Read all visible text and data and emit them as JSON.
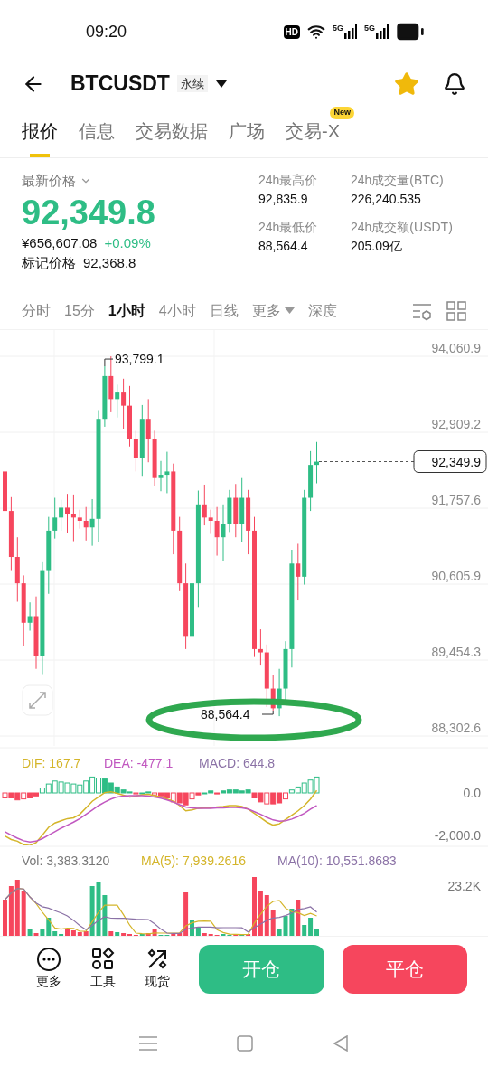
{
  "status_bar": {
    "time": "09:20",
    "hd": "HD",
    "sims": [
      "5G",
      "5G"
    ]
  },
  "header": {
    "symbol": "BTCUSDT",
    "contract_tag": "永续",
    "favorite": true
  },
  "tabs": [
    {
      "label": "报价",
      "selected": true
    },
    {
      "label": "信息",
      "selected": false
    },
    {
      "label": "交易数据",
      "selected": false
    },
    {
      "label": "广场",
      "selected": false
    },
    {
      "label": "交易-X",
      "selected": false,
      "badge": "New"
    }
  ],
  "price": {
    "label": "最新价格",
    "last": "92,349.8",
    "cny": "¥656,607.08",
    "change": "+0.09%",
    "mark_label": "标记价格",
    "mark_value": "92,368.8"
  },
  "stats": [
    {
      "label": "24h最高价",
      "value": "92,835.9"
    },
    {
      "label": "24h成交量(BTC)",
      "value": "226,240.535"
    },
    {
      "label": "24h最低价",
      "value": "88,564.4"
    },
    {
      "label": "24h成交额(USDT)",
      "value": "205.09亿"
    }
  ],
  "intervals": [
    {
      "label": "分时",
      "selected": false,
      "kind": "plain"
    },
    {
      "label": "15分",
      "selected": false,
      "kind": "plain"
    },
    {
      "label": "1小时",
      "selected": true,
      "kind": "plain"
    },
    {
      "label": "4小时",
      "selected": false,
      "kind": "plain"
    },
    {
      "label": "日线",
      "selected": false,
      "kind": "plain"
    },
    {
      "label": "更多",
      "selected": false,
      "kind": "dropdown"
    },
    {
      "label": "深度",
      "selected": false,
      "kind": "plain"
    }
  ],
  "chart": {
    "y_labels": [
      "94,060.9",
      "92,909.2",
      "91,757.6",
      "90,605.9",
      "89,454.3",
      "88,302.6"
    ],
    "high_label": "93,799.1",
    "low_label": "88,564.4",
    "current_price": "92,349.9"
  },
  "macd": {
    "dif": "DIF: 167.7",
    "dea": "DEA: -477.1",
    "macd": "MACD: 644.8",
    "y_labels": [
      "0.0",
      "-2,000.0"
    ]
  },
  "volume": {
    "vol": "Vol: 3,383.3120",
    "ma5": "MA(5): 7,939.2616",
    "ma10": "MA(10): 10,551.8683",
    "y_label": "23.2K"
  },
  "bottom_bar": {
    "tools": [
      {
        "label": "更多",
        "kind": "more"
      },
      {
        "label": "工具",
        "kind": "tools"
      },
      {
        "label": "现货",
        "kind": "spot"
      }
    ],
    "open": "开仓",
    "close": "平仓"
  }
}
